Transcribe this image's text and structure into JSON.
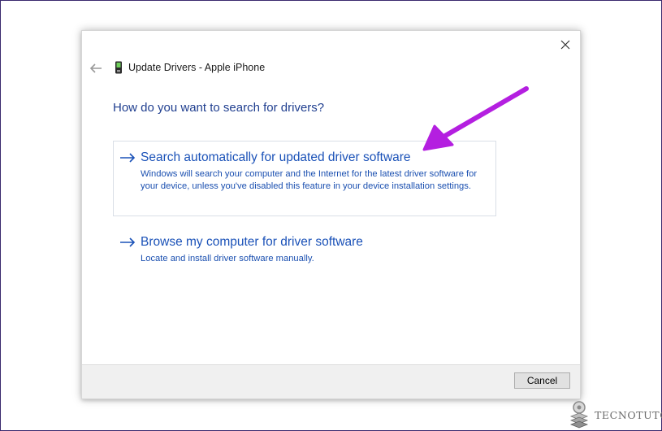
{
  "window": {
    "title": "Update Drivers - Apple iPhone"
  },
  "heading": "How do you want to search for drivers?",
  "options": [
    {
      "title": "Search automatically for updated driver software",
      "description": "Windows will search your computer and the Internet for the latest driver software for your device, unless you've disabled this feature in your device installation settings."
    },
    {
      "title": "Browse my computer for driver software",
      "description": "Locate and install driver software manually."
    }
  ],
  "footer": {
    "cancel_label": "Cancel"
  },
  "annotation": {
    "color": "#b41fe0"
  },
  "watermark": {
    "text": "TECNOTUTO"
  },
  "icons": {
    "close": "close-icon",
    "back": "back-arrow-icon",
    "device": "phone-icon",
    "option_arrow": "right-arrow-icon"
  },
  "colors": {
    "link": "#1b52b8",
    "heading": "#1f3e8f"
  }
}
